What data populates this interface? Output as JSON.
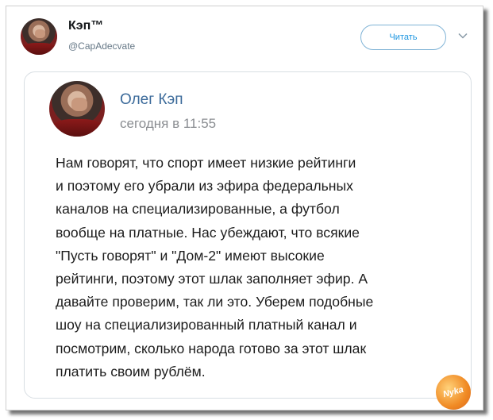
{
  "author": {
    "name": "Кэп™",
    "handle": "@CapAdecvate"
  },
  "follow_button": {
    "label": "Читать"
  },
  "quoted_post": {
    "name": "Олег Кэп",
    "timestamp": "сегодня в 11:55",
    "text": "Нам говорят, что спорт имеет низкие рейтинги\nи поэтому его убрали из эфира федеральных\nканалов на специализированные, а футбол\nвообще на платные. Нас убеждают, что всякие\n\"Пусть говорят\" и \"Дом-2\" имеют высокие\nрейтинги, поэтому этот шлак заполняет эфир. А\nдавайте проверим, так ли это. Уберем подобные\nшоу на специализированный платный канал и\nпосмотрим, сколько народа готово за этот шлак\nплатить своим рублём."
  },
  "watermark": {
    "text": "Nyka"
  },
  "icons": {
    "menu": "chevron-down-icon",
    "avatar": "avatar-image"
  },
  "colors": {
    "follow_accent": "#1b95e0",
    "name_link": "#3b6a9a",
    "muted": "#657786"
  }
}
